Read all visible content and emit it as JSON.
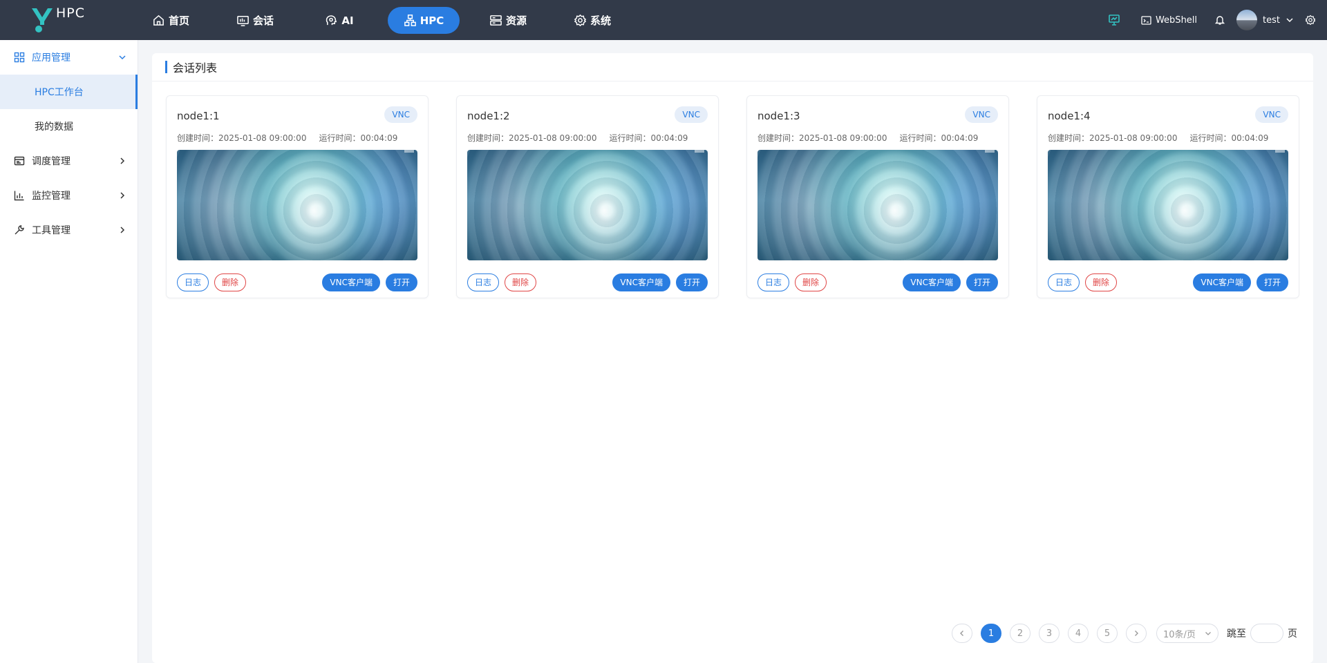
{
  "app": {
    "name": "HPC"
  },
  "nav": [
    {
      "label": "首页",
      "icon": "home-icon"
    },
    {
      "label": "会话",
      "icon": "session-icon"
    },
    {
      "label": "AI",
      "icon": "ai-icon"
    },
    {
      "label": "HPC",
      "icon": "hpc-icon",
      "active": true
    },
    {
      "label": "资源",
      "icon": "server-icon"
    },
    {
      "label": "系统",
      "icon": "gear-icon"
    }
  ],
  "topbar": {
    "webshell_label": "WebShell",
    "username": "test"
  },
  "sidebar": {
    "app_mgmt": "应用管理",
    "hpc_workbench": "HPC工作台",
    "my_data": "我的数据",
    "schedule_mgmt": "调度管理",
    "monitor_mgmt": "监控管理",
    "tool_mgmt": "工具管理"
  },
  "main": {
    "title": "会话列表"
  },
  "sessions": [
    {
      "name": "node1:1",
      "badge": "VNC",
      "created": "创建时间：2025-01-08 09:00:00",
      "runtime": "运行时间：00:04:09",
      "log": "日志",
      "del": "删除",
      "vnc": "VNC客户端",
      "open": "打开"
    },
    {
      "name": "node1:2",
      "badge": "VNC",
      "created": "创建时间：2025-01-08 09:00:00",
      "runtime": "运行时间：00:04:09",
      "log": "日志",
      "del": "删除",
      "vnc": "VNC客户端",
      "open": "打开"
    },
    {
      "name": "node1:3",
      "badge": "VNC",
      "created": "创建时间：2025-01-08 09:00:00",
      "runtime": "运行时间：00:04:09",
      "log": "日志",
      "del": "删除",
      "vnc": "VNC客户端",
      "open": "打开"
    },
    {
      "name": "node1:4",
      "badge": "VNC",
      "created": "创建时间：2025-01-08 09:00:00",
      "runtime": "运行时间：00:04:09",
      "log": "日志",
      "del": "删除",
      "vnc": "VNC客户端",
      "open": "打开"
    }
  ],
  "pagination": {
    "pages": [
      "1",
      "2",
      "3",
      "4",
      "5"
    ],
    "current": "1",
    "page_size": "10条/页",
    "jump_label": "跳至",
    "page_suffix": "页"
  },
  "colors": {
    "topbar": "#323a49",
    "accent": "#2a7de1",
    "danger": "#e04545",
    "logo": "#33c2c2"
  }
}
